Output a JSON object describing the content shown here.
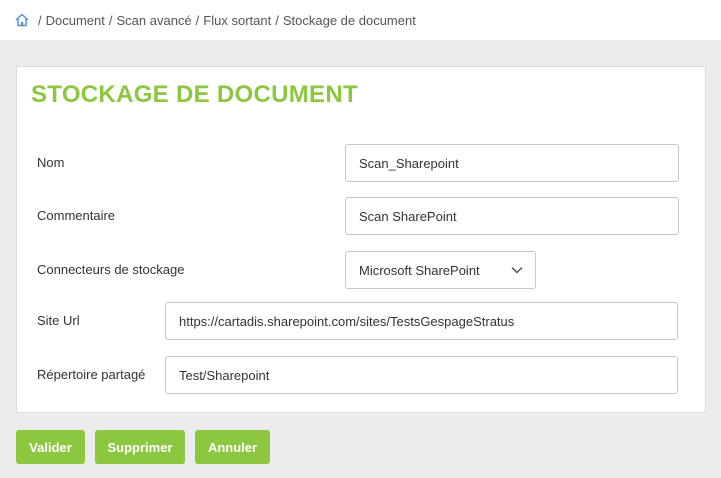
{
  "breadcrumb": {
    "items": [
      "Document",
      "Scan avancé",
      "Flux sortant",
      "Stockage de document"
    ],
    "separator": "/"
  },
  "panel": {
    "title": "STOCKAGE DE DOCUMENT"
  },
  "form": {
    "nom": {
      "label": "Nom",
      "value": "Scan_Sharepoint"
    },
    "commentaire": {
      "label": "Commentaire",
      "value": "Scan SharePoint"
    },
    "connecteurs": {
      "label": "Connecteurs de stockage",
      "selected": "Microsoft SharePoint"
    },
    "site_url": {
      "label": "Site Url",
      "value": "https://cartadis.sharepoint.com/sites/TestsGespageStratus"
    },
    "repertoire": {
      "label": "Répertoire partagé",
      "value": "Test/Sharepoint"
    }
  },
  "actions": {
    "valider": "Valider",
    "supprimer": "Supprimer",
    "annuler": "Annuler"
  },
  "colors": {
    "accent": "#8dc63f",
    "home_icon": "#4a90d9"
  },
  "icons": {
    "home": "home-icon",
    "dropdown": "chevron-down-icon"
  }
}
